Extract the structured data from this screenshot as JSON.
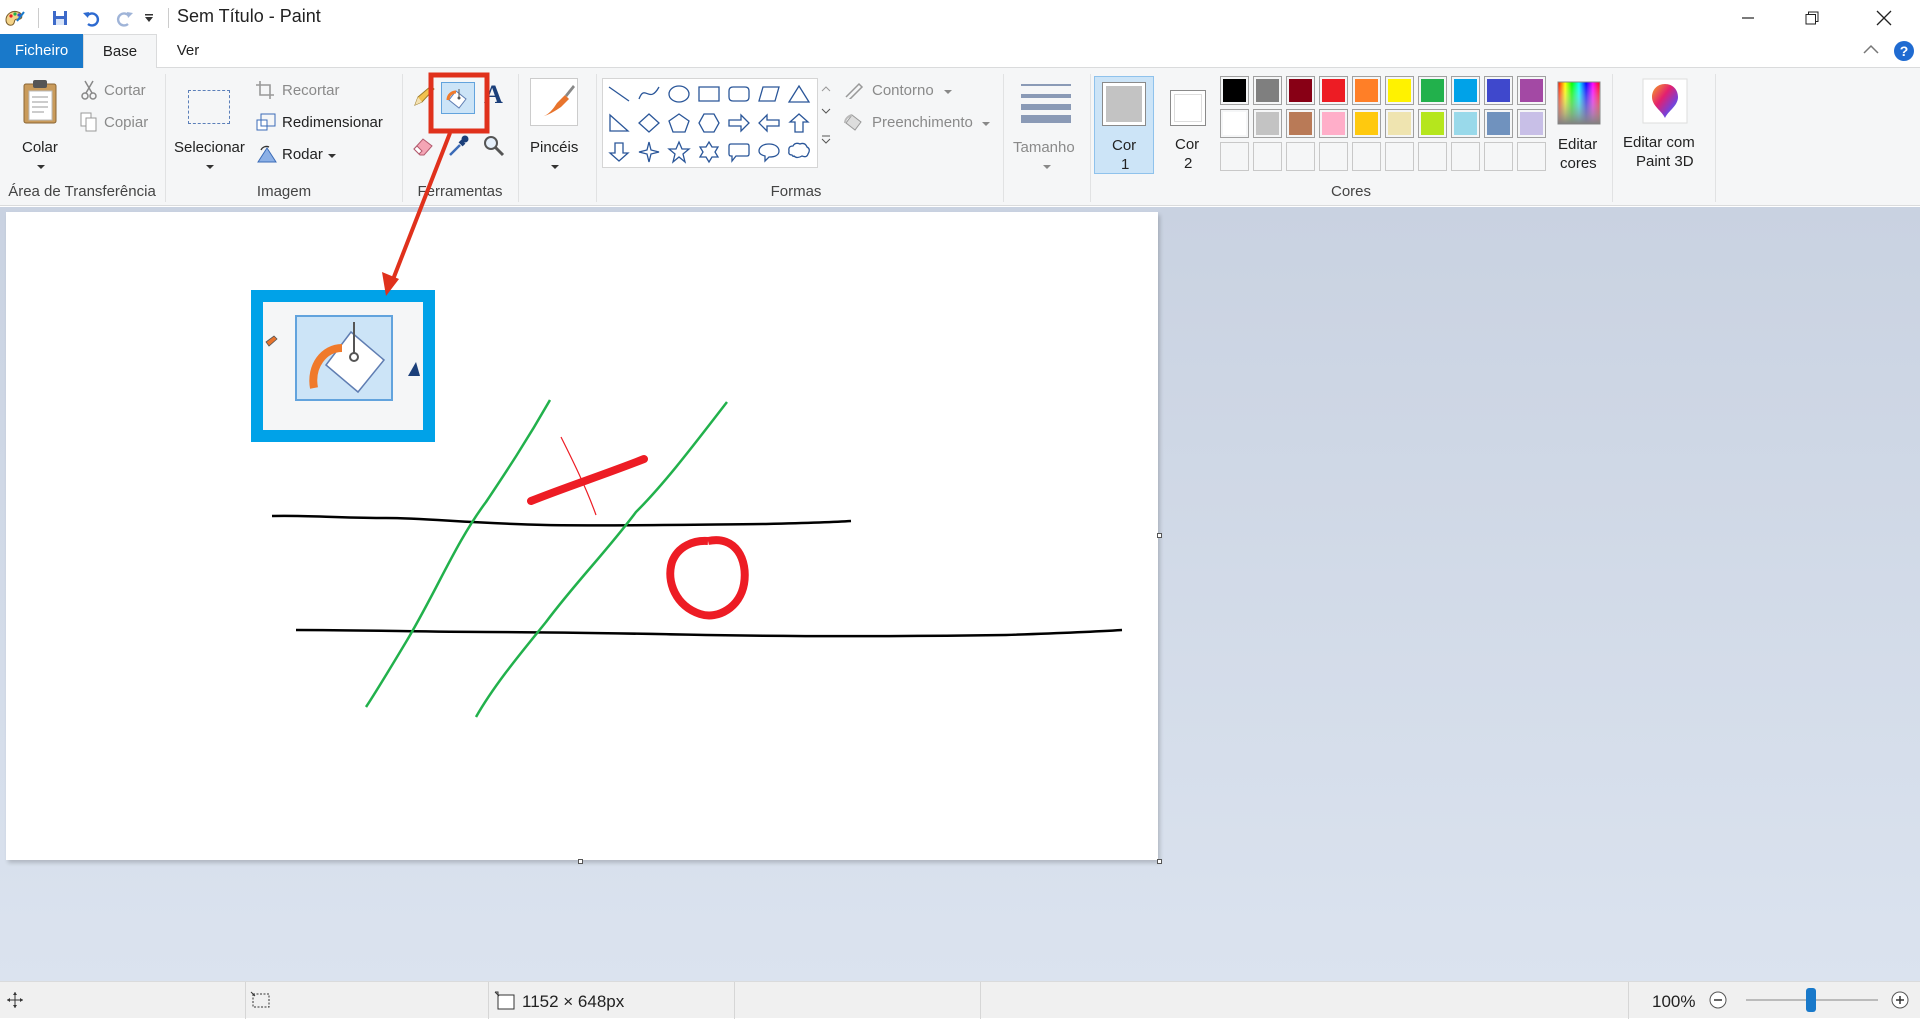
{
  "window": {
    "title": "Sem Título - Paint"
  },
  "tabs": {
    "file": "Ficheiro",
    "home": "Base",
    "view": "Ver"
  },
  "clipboard": {
    "paste": "Colar",
    "cut": "Cortar",
    "copy": "Copiar",
    "group": "Área de Transferência"
  },
  "image": {
    "select": "Selecionar",
    "crop": "Recortar",
    "resize": "Redimensionar",
    "rotate": "Rodar",
    "group": "Imagem"
  },
  "tools": {
    "group": "Ferramentas",
    "text_icon": "A"
  },
  "brushes": {
    "label": "Pincéis"
  },
  "shapes": {
    "outline": "Contorno",
    "fill": "Preenchimento",
    "group": "Formas"
  },
  "size": {
    "label": "Tamanho"
  },
  "colors": {
    "color1_line1": "Cor",
    "color1_line2": "1",
    "color2_line1": "Cor",
    "color2_line2": "2",
    "edit_line1": "Editar",
    "edit_line2": "cores",
    "group": "Cores",
    "color1_value": "#c3c3c3",
    "color2_value": "#ffffff",
    "palette_row1": [
      "#000000",
      "#7f7f7f",
      "#880015",
      "#ed1c24",
      "#ff7f27",
      "#fff200",
      "#22b14c",
      "#00a2e8",
      "#3f48cc",
      "#a349a4"
    ],
    "palette_row2": [
      "#ffffff",
      "#c3c3c3",
      "#b97a57",
      "#ffaec9",
      "#ffc90e",
      "#efe4b0",
      "#b5e61d",
      "#99d9ea",
      "#7092be",
      "#c8bfe7"
    ],
    "palette_row3": [
      "#f5f6f7",
      "#f5f6f7",
      "#f5f6f7",
      "#f5f6f7",
      "#f5f6f7",
      "#f5f6f7",
      "#f5f6f7",
      "#f5f6f7",
      "#f5f6f7",
      "#f5f6f7"
    ]
  },
  "paint3d": {
    "line1": "Editar com",
    "line2": "Paint 3D"
  },
  "status": {
    "dimensions": "1152 × 648px",
    "zoom": "100%"
  },
  "accent": "#1979ca"
}
